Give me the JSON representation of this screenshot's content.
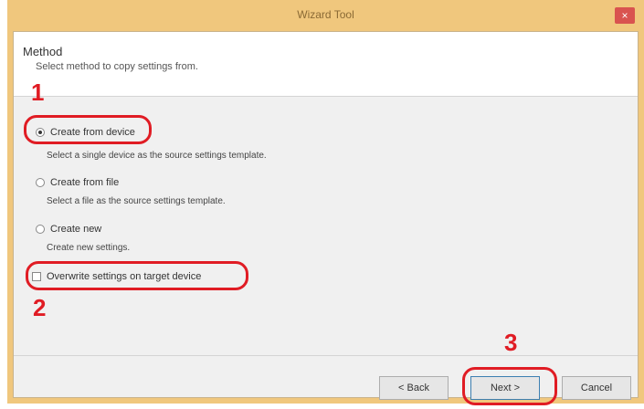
{
  "window": {
    "title": "Wizard Tool",
    "close_label": "×"
  },
  "header": {
    "title": "Method",
    "subtitle": "Select method to copy settings from."
  },
  "options": [
    {
      "label": "Create from device",
      "description": "Select a single device as the source settings template."
    },
    {
      "label": "Create from file",
      "description": "Select a file as the source settings template."
    },
    {
      "label": "Create new",
      "description": "Create new settings."
    }
  ],
  "overwrite_checkbox": {
    "label": "Overwrite settings on target device",
    "checked": false
  },
  "buttons": {
    "back": "< Back",
    "next": "Next >",
    "cancel": "Cancel"
  },
  "steps": [
    "1",
    "2",
    "3"
  ],
  "colors": {
    "highlight": "#e01c24",
    "titlebar": "#f0c77d",
    "close": "#d9534f"
  }
}
